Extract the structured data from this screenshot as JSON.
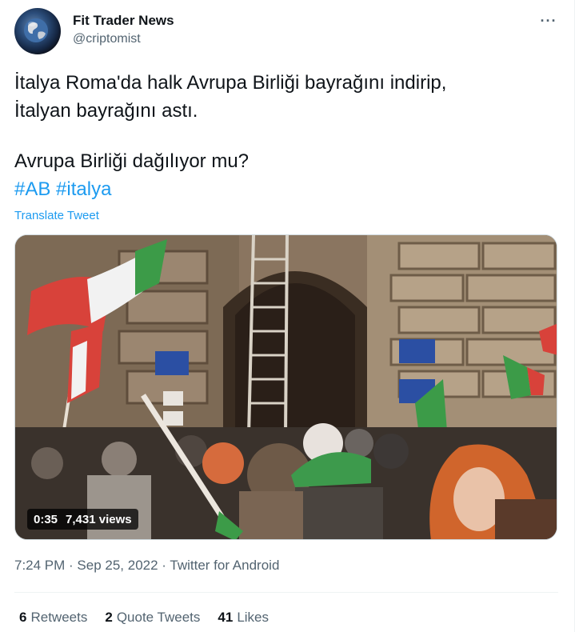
{
  "header": {
    "display_name": "Fit Trader News",
    "handle": "@criptomist",
    "more_icon": "more-dots-icon"
  },
  "tweet": {
    "line1": "İtalya Roma'da halk Avrupa Birliği bayrağını indirip,",
    "line2": "İtalyan bayrağını astı.",
    "line3": "Avrupa Birliği dağılıyor mu?",
    "hashtag1": "#AB",
    "hashtag2": "#italya",
    "translate_label": "Translate Tweet"
  },
  "media": {
    "duration": "0:35",
    "views": "7,431 views"
  },
  "meta": {
    "time": "7:24 PM",
    "separator1": " · ",
    "date": "Sep 25, 2022",
    "separator2": " · ",
    "source": "Twitter for Android"
  },
  "stats": {
    "retweets_count": "6",
    "retweets_label": "Retweets",
    "quotes_count": "2",
    "quotes_label": "Quote Tweets",
    "likes_count": "41",
    "likes_label": "Likes"
  },
  "colors": {
    "accent": "#1d9bf0",
    "secondary_text": "#536471",
    "primary_text": "#0f1419"
  }
}
